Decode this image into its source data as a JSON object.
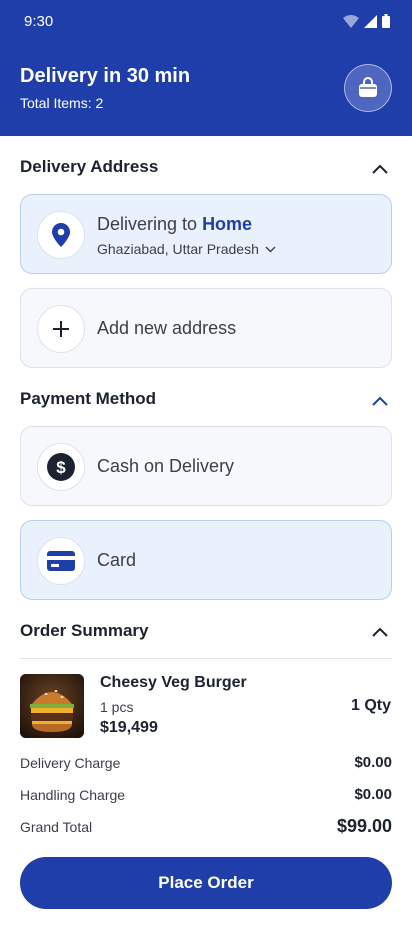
{
  "status_bar": {
    "time": "9:30"
  },
  "header": {
    "title": "Delivery in 30 min",
    "subtitle": "Total Items: 2",
    "bag_icon": "shopping-bag-icon"
  },
  "delivery_address": {
    "title": "Delivery Address",
    "selected": {
      "prefix": "Delivering to",
      "name": "Home",
      "location": "Ghaziabad, Uttar Pradesh"
    },
    "add_new_label": "Add new address"
  },
  "payment_method": {
    "title": "Payment Method",
    "options": [
      {
        "label": "Cash on Delivery",
        "icon": "dollar-icon"
      },
      {
        "label": "Card",
        "icon": "credit-card-icon"
      }
    ]
  },
  "order_summary": {
    "title": "Order Summary",
    "item": {
      "name": "Cheesy Veg Burger",
      "unit": "1 pcs",
      "price": "$19,499",
      "qty": "1 Qty"
    },
    "delivery_charge": {
      "label": "Delivery Charge",
      "value": "$0.00"
    },
    "handling_charge": {
      "label": "Handling Charge",
      "value": "$0.00"
    },
    "grand_total": {
      "label": "Grand Total",
      "value": "$99.00"
    }
  },
  "place_order_label": "Place Order",
  "colors": {
    "primary": "#1f3eaa",
    "selected_bg": "#e9f1fd"
  }
}
